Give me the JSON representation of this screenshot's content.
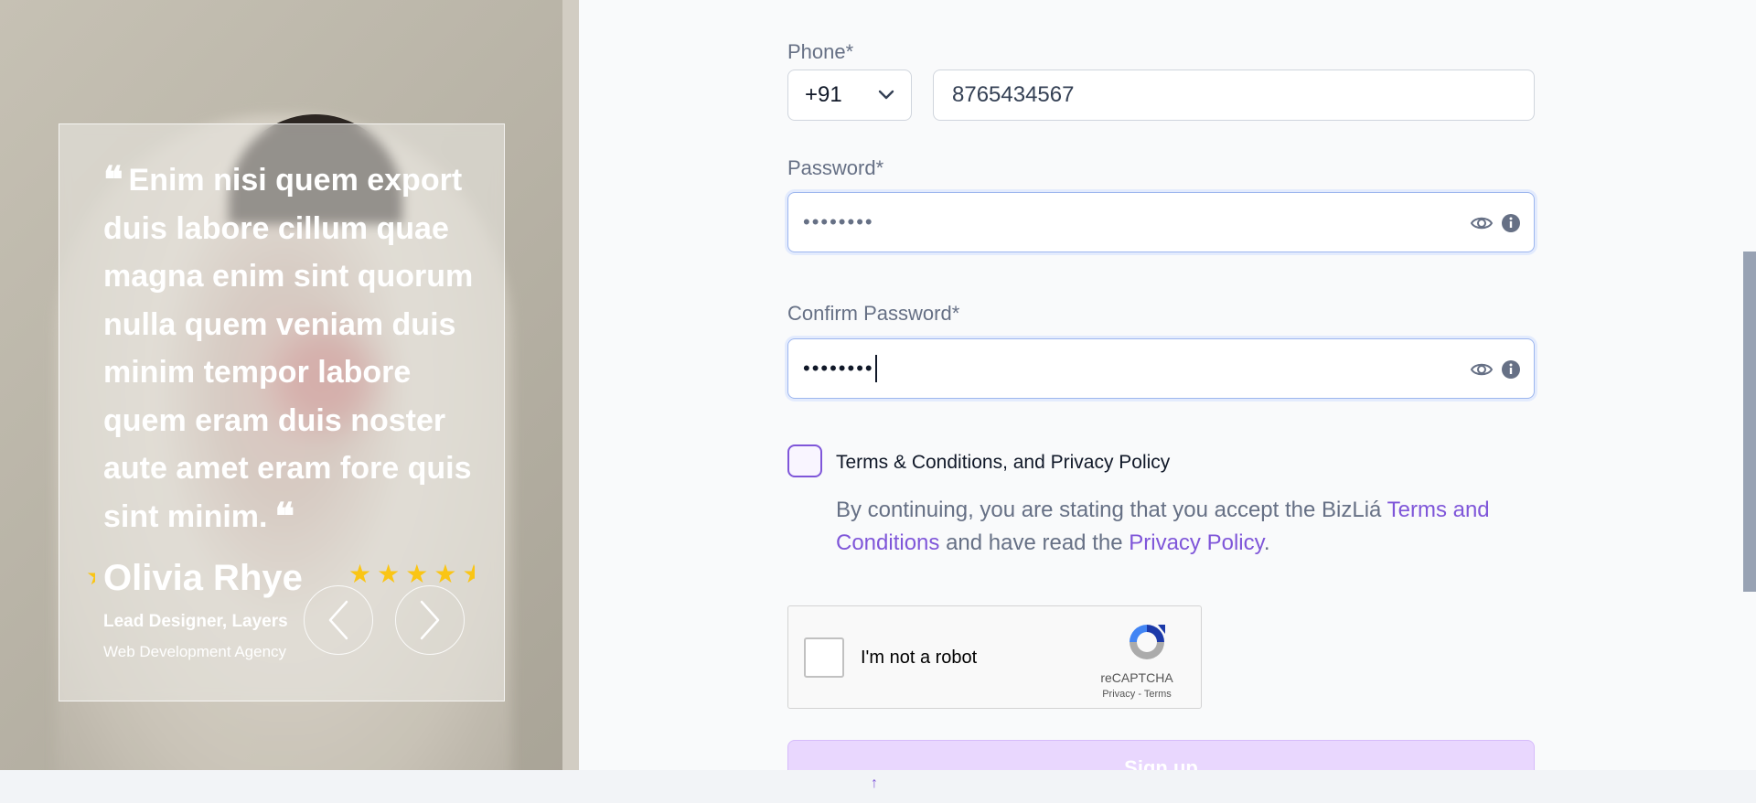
{
  "testimonial": {
    "quote": "Enim nisi quem export duis labore cillum quae magna enim sint quorum nulla quem veniam duis minim tempor labore quem eram duis noster aute amet eram fore quis sint minim.",
    "quote_open": "❝",
    "quote_close": "❝",
    "name": "Olivia Rhye",
    "role": "Lead Designer, Layers",
    "company": "Web Development Agency",
    "rating": 4.5,
    "star_color": "#fac515"
  },
  "form": {
    "phone": {
      "label": "Phone*",
      "country_code": "+91",
      "value": "8765434567"
    },
    "password": {
      "label": "Password*",
      "value": "••••••••"
    },
    "confirm_password": {
      "label": "Confirm Password*",
      "value": "••••••••"
    },
    "terms": {
      "title": "Terms & Conditions, and Privacy Policy",
      "text_before": "By continuing, you are stating that you accept the BizLiá ",
      "link_terms": "Terms and Conditions",
      "text_middle": " and have read the ",
      "link_privacy": "Privacy Policy",
      "text_after": "."
    },
    "recaptcha": {
      "label": "I'm not a robot",
      "brand": "reCAPTCHA",
      "links": "Privacy - Terms"
    },
    "submit_label": "Sign up"
  },
  "colors": {
    "accent": "#7f56d9",
    "input_focus": "#9db6ee",
    "text_muted": "#667085"
  },
  "scroll_top_icon": "↑"
}
